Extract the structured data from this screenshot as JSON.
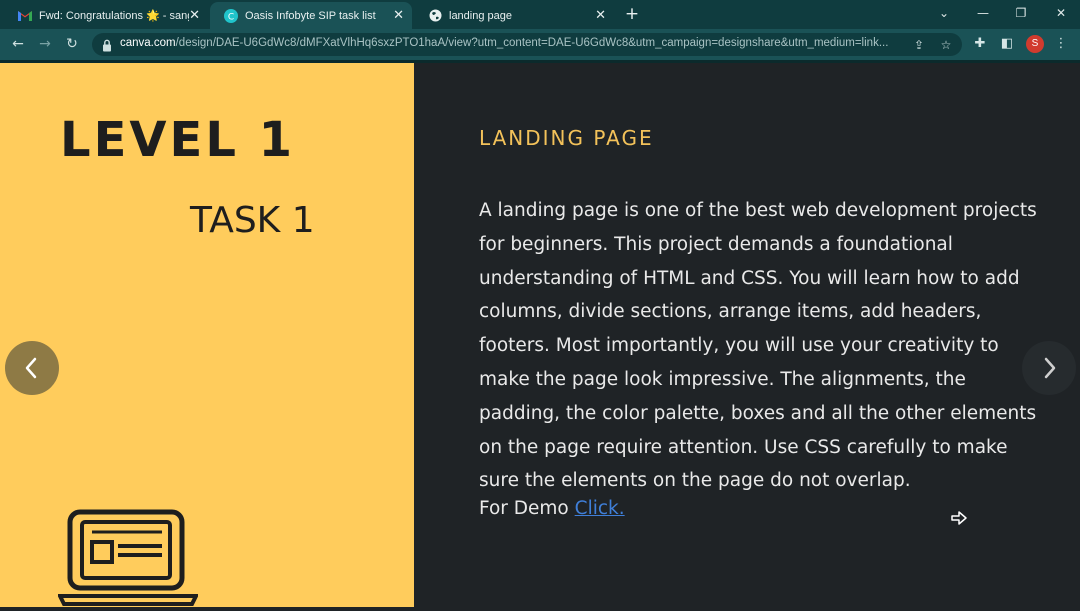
{
  "browser": {
    "tabs": [
      {
        "title": "Fwd: Congratulations 🌟 - sangi",
        "favicon": "gmail-icon"
      },
      {
        "title": "Oasis Infobyte SIP task list",
        "favicon": "canva-icon"
      },
      {
        "title": "landing page",
        "favicon": "globe-icon"
      }
    ],
    "url_host": "canva.com",
    "url_path": "/design/DAE-U6GdWc8/dMFXatVlhHq6sxzPTO1haA/view?utm_content=DAE-U6GdWc8&utm_campaign=designshare&utm_medium=link...",
    "profile_initial": "S",
    "colors": {
      "tabbar": "#0f3c3f",
      "toolbar": "#1a5256",
      "profile": "#d13b2e"
    }
  },
  "slide": {
    "level_title": "LEVEL 1",
    "task_title": "TASK 1",
    "heading": "LANDING PAGE",
    "paragraph": "A landing page is one of the best web development projects for beginners. This project demands a foundational understanding of HTML and CSS. You will learn how to add columns, divide sections, arrange items, add headers, footers. Most importantly, you will use your creativity to make the page look impressive. The alignments, the padding, the color palette, boxes and all the other elements on the page require attention. Use CSS carefully to make sure the elements on the page do not overlap.",
    "demo_label": "For Demo",
    "demo_link": "Click.",
    "colors": {
      "left_bg": "#ffcc5c",
      "right_bg": "#1f2326",
      "heading": "#f3c25a",
      "link": "#3f7fd9"
    }
  },
  "navigation": {
    "prev_icon": "chevron-left-icon",
    "next_icon": "chevron-right-icon"
  }
}
